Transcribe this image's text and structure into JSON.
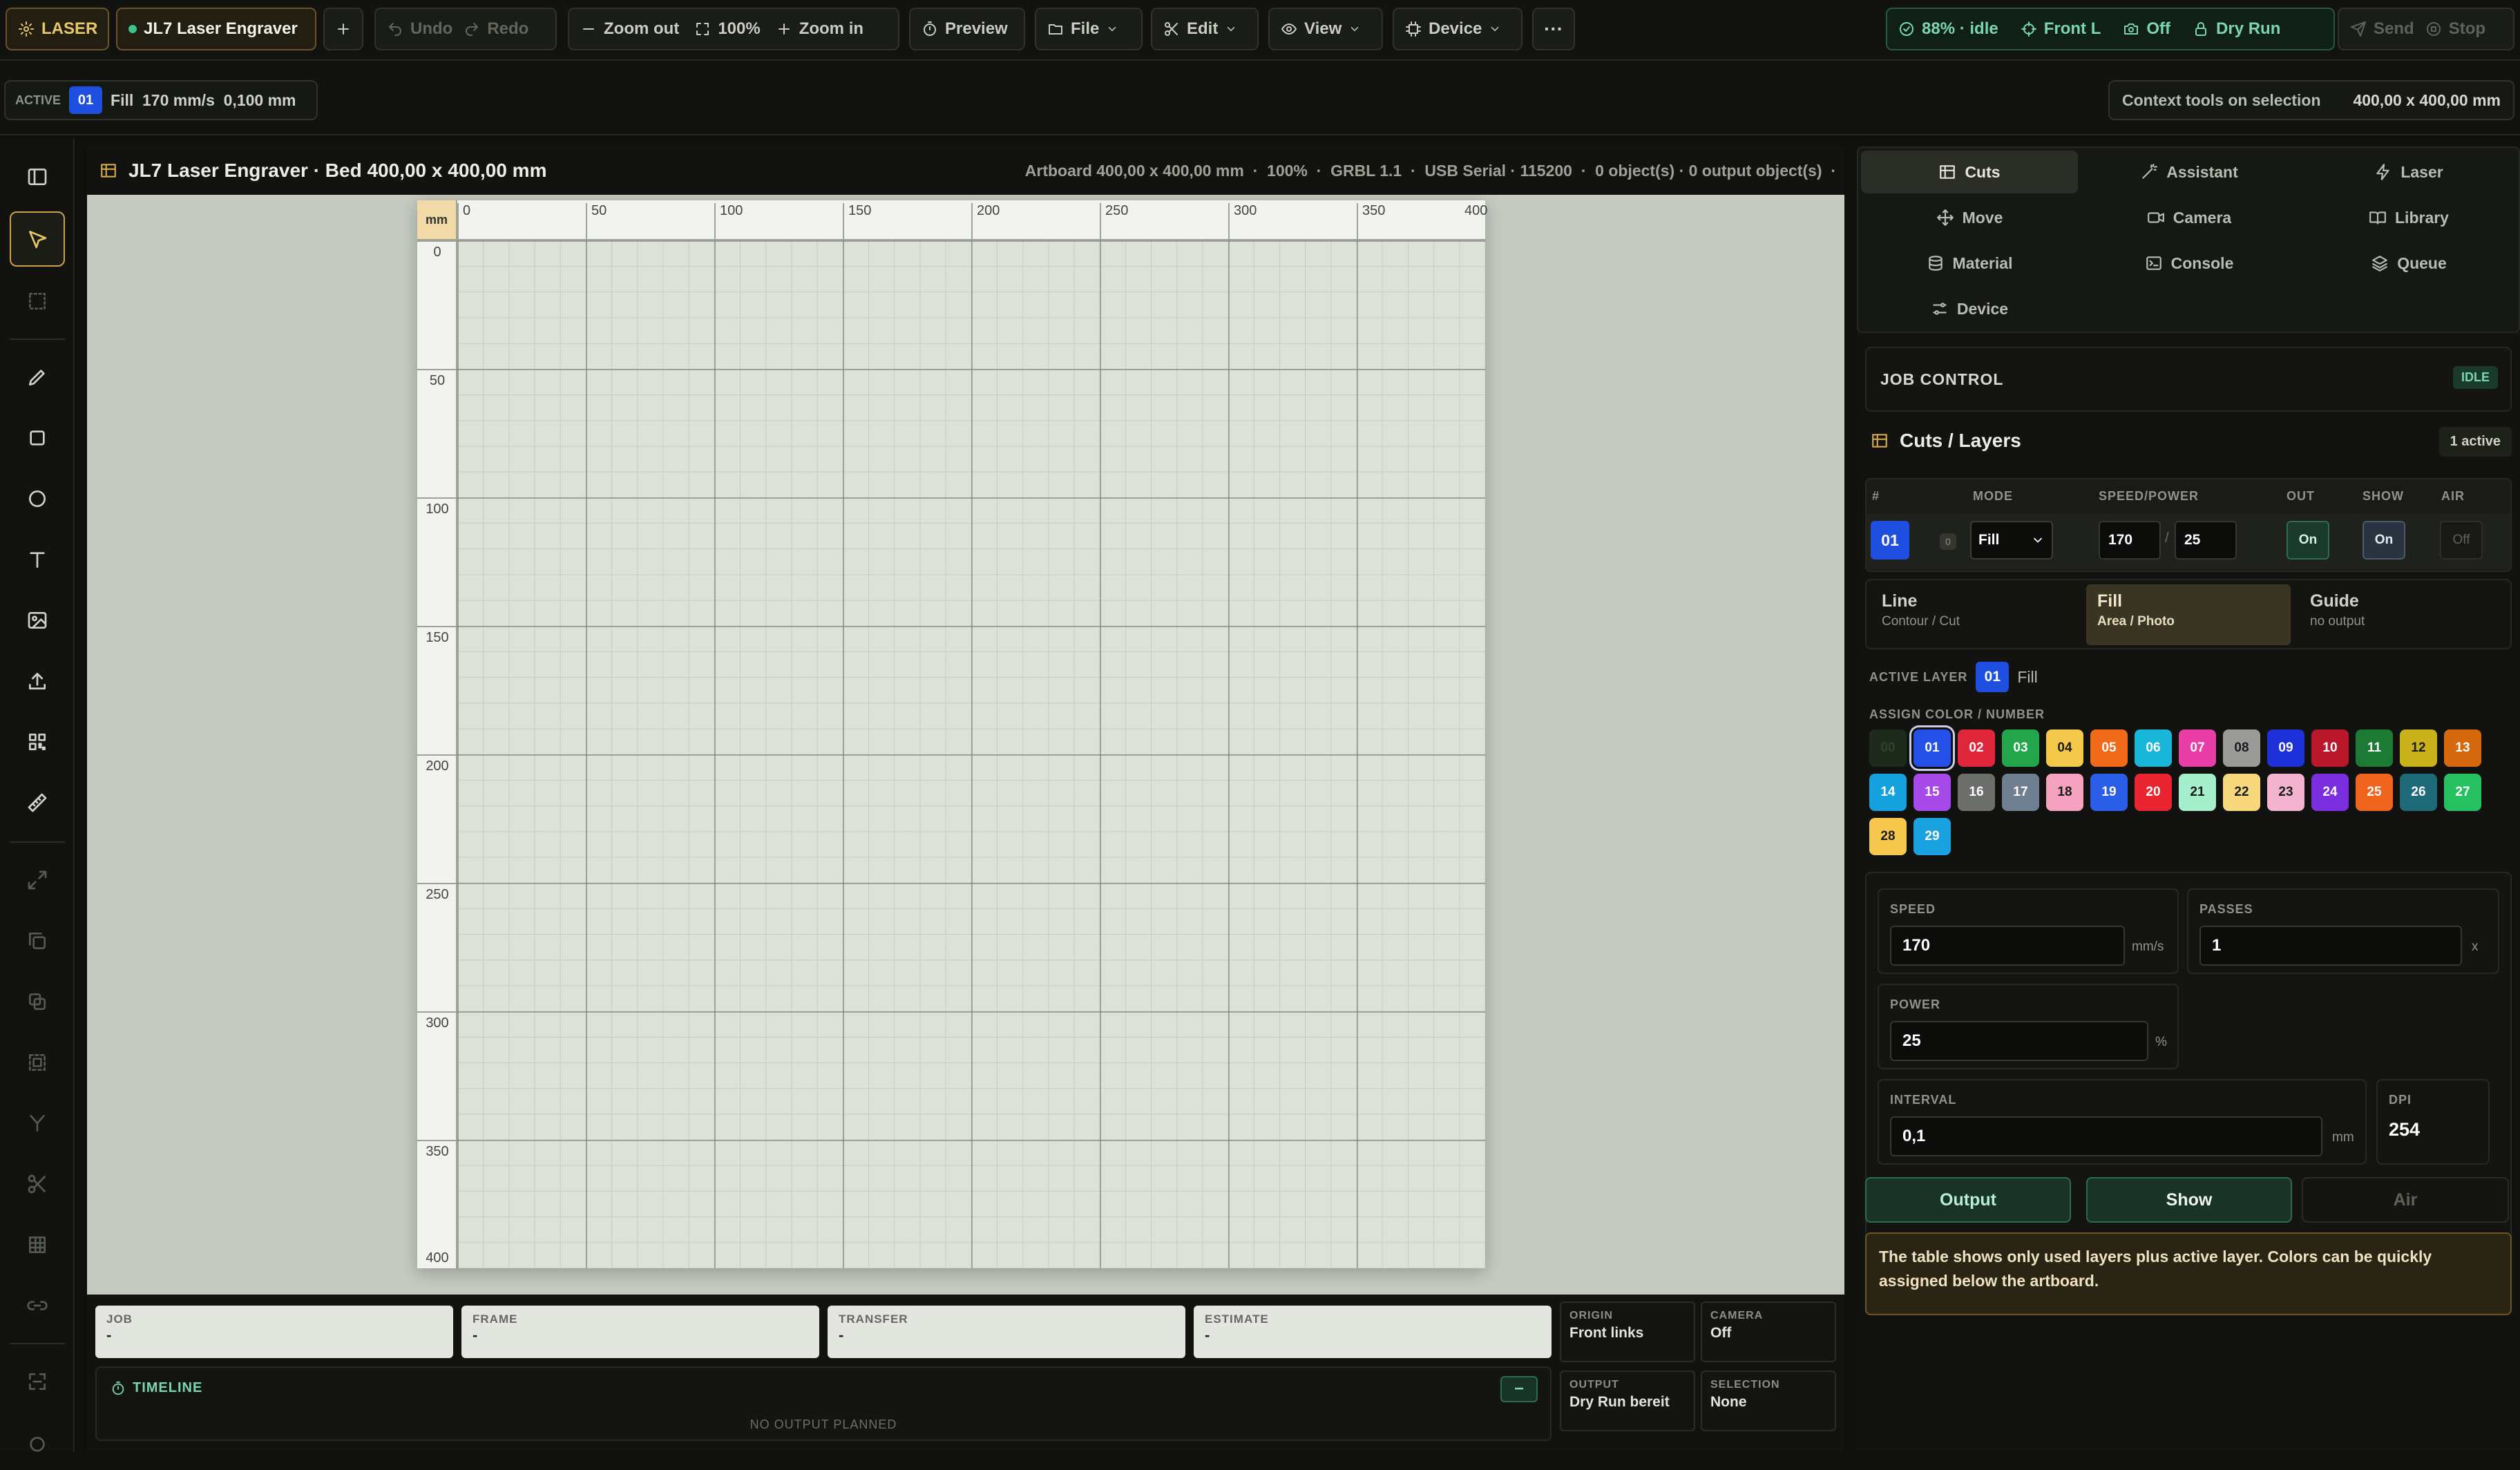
{
  "topbar": {
    "app_label": "LASER",
    "device_name": "JL7 Laser Engraver",
    "undo": "Undo",
    "redo": "Redo",
    "zoom_out": "Zoom out",
    "zoom_level": "100%",
    "zoom_in": "Zoom in",
    "preview": "Preview",
    "file": "File",
    "edit": "Edit",
    "view": "View",
    "device": "Device",
    "status_idle": "88% · idle",
    "front": "Front L",
    "camera": "Off",
    "dry_run": "Dry Run",
    "send": "Send",
    "stop": "Stop"
  },
  "subbar": {
    "active_label": "ACTIVE",
    "layer_num": "01",
    "layer_info": "Fill  170 mm/s  0,100 mm",
    "context_label": "Context tools on selection",
    "selection_size": "400,00 x 400,00 mm"
  },
  "canvas": {
    "title": "JL7 Laser Engraver · Bed 400,00 x 400,00 mm",
    "meta": "Artboard 400,00 x 400,00 mm  ·  100%  ·  GRBL 1.1  ·  USB Serial · 115200  ·  0 object(s) · 0 output object(s)  ·",
    "unit": "mm",
    "ticks": [
      "0",
      "50",
      "100",
      "150",
      "200",
      "250",
      "300",
      "350",
      "400"
    ]
  },
  "status": {
    "job": {
      "label": "JOB",
      "value": "-"
    },
    "frame": {
      "label": "FRAME",
      "value": "-"
    },
    "transfer": {
      "label": "TRANSFER",
      "value": "-"
    },
    "estimate": {
      "label": "ESTIMATE",
      "value": "-"
    },
    "origin": {
      "label": "ORIGIN",
      "value": "Front links"
    },
    "camera": {
      "label": "CAMERA",
      "value": "Off"
    },
    "output": {
      "label": "OUTPUT",
      "value": "Dry Run bereit"
    },
    "selection": {
      "label": "SELECTION",
      "value": "None"
    },
    "timeline_label": "TIMELINE",
    "timeline_empty": "NO OUTPUT PLANNED",
    "timeline_btn": "−"
  },
  "panel": {
    "tabs": [
      "Cuts",
      "Assistant",
      "Laser",
      "Move",
      "Camera",
      "Library",
      "Material",
      "Console",
      "Queue",
      "Device"
    ],
    "job_control": "JOB CONTROL",
    "job_state": "IDLE",
    "cuts_title": "Cuts / Layers",
    "active_count": "1 active",
    "cols": [
      "#",
      "MODE",
      "SPEED/POWER",
      "OUT",
      "SHOW",
      "AIR"
    ],
    "layer": {
      "num": "01",
      "order": "0",
      "mode": "Fill",
      "speed": "170",
      "sep": "/",
      "power": "25",
      "out": "On",
      "show": "On",
      "air": "Off"
    },
    "modes": [
      {
        "title": "Line",
        "sub": "Contour / Cut"
      },
      {
        "title": "Fill",
        "sub": "Area / Photo"
      },
      {
        "title": "Guide",
        "sub": "no output"
      }
    ],
    "active_layer_label": "ACTIVE LAYER",
    "active_layer_num": "01",
    "active_layer_mode": "Fill",
    "assign_label": "ASSIGN COLOR / NUMBER",
    "swatches": [
      {
        "n": "00",
        "c": "#1e2a1c"
      },
      {
        "n": "01",
        "c": "#2450e8"
      },
      {
        "n": "02",
        "c": "#e0263b"
      },
      {
        "n": "03",
        "c": "#22a54b"
      },
      {
        "n": "04",
        "c": "#f4c84a"
      },
      {
        "n": "05",
        "c": "#f06a1a"
      },
      {
        "n": "06",
        "c": "#18b6d8"
      },
      {
        "n": "07",
        "c": "#e83ea5"
      },
      {
        "n": "08",
        "c": "#9a9b98"
      },
      {
        "n": "09",
        "c": "#1e30d8"
      },
      {
        "n": "10",
        "c": "#b8182a"
      },
      {
        "n": "11",
        "c": "#1d7a34"
      },
      {
        "n": "12",
        "c": "#c9b21a"
      },
      {
        "n": "13",
        "c": "#d6680e"
      },
      {
        "n": "14",
        "c": "#15a0de"
      },
      {
        "n": "15",
        "c": "#a54ae8"
      },
      {
        "n": "16",
        "c": "#6b6e6a"
      },
      {
        "n": "17",
        "c": "#6f7f90"
      },
      {
        "n": "18",
        "c": "#f4a2c0"
      },
      {
        "n": "19",
        "c": "#2a5ee8"
      },
      {
        "n": "20",
        "c": "#ea2430"
      },
      {
        "n": "21",
        "c": "#a5efcc"
      },
      {
        "n": "22",
        "c": "#f8d87c"
      },
      {
        "n": "23",
        "c": "#f4b4d0"
      },
      {
        "n": "24",
        "c": "#7a2ee0"
      },
      {
        "n": "25",
        "c": "#f0641e"
      },
      {
        "n": "26",
        "c": "#1e6a78"
      },
      {
        "n": "27",
        "c": "#26c060"
      },
      {
        "n": "28",
        "c": "#f6c84e"
      },
      {
        "n": "29",
        "c": "#1aa2e0"
      }
    ],
    "speed_label": "SPEED",
    "speed_value": "170",
    "speed_unit": "mm/s",
    "passes_label": "PASSES",
    "passes_value": "1",
    "passes_unit": "x",
    "power_label": "POWER",
    "power_value": "25",
    "power_unit": "%",
    "interval_label": "INTERVAL",
    "interval_value": "0,1",
    "interval_unit": "mm",
    "dpi_label": "DPI",
    "dpi_value": "254",
    "btn_output": "Output",
    "btn_show": "Show",
    "btn_air": "Air",
    "note": "The table shows only used layers plus active layer. Colors can be quickly assigned below the artboard."
  },
  "colors": {
    "accent": "#c9a24a",
    "active_blue": "#2450e8",
    "green": "#1f3d30",
    "idle": "#7ad6b0"
  }
}
